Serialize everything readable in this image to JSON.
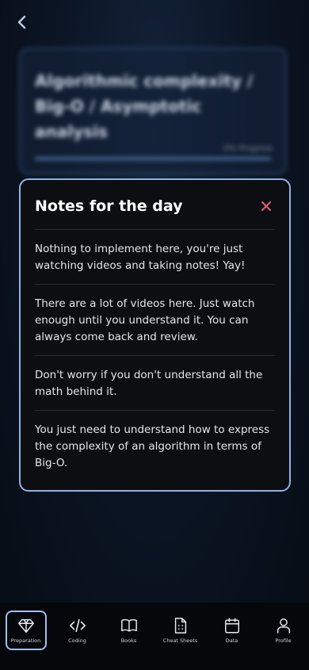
{
  "background_card": {
    "title": "Algorithmic complexity / Big-O / Asymptotic analysis",
    "progress_label": "0% Progress"
  },
  "modal": {
    "title": "Notes for the day",
    "notes": [
      "Nothing to implement here, you're just watching videos and taking notes! Yay!",
      "There are a lot of videos here. Just watch enough until you understand it. You can always come back and review.",
      "Don't worry if you don't understand all the math behind it.",
      "You just need to understand how to express the complexity of an algorithm in terms of Big-O."
    ]
  },
  "tabbar": {
    "items": [
      {
        "label": "Preparation",
        "icon": "diamond-icon",
        "active": true
      },
      {
        "label": "Coding",
        "icon": "code-icon",
        "active": false
      },
      {
        "label": "Books",
        "icon": "book-icon",
        "active": false
      },
      {
        "label": "Cheat Sheets",
        "icon": "cheat-sheet-icon",
        "active": false
      },
      {
        "label": "Data",
        "icon": "calendar-icon",
        "active": false
      },
      {
        "label": "Profile",
        "icon": "profile-icon",
        "active": false
      }
    ]
  },
  "colors": {
    "accent_border": "#8fb2e6",
    "close_icon": "#e0607e",
    "modal_bg": "#0d0e12"
  }
}
